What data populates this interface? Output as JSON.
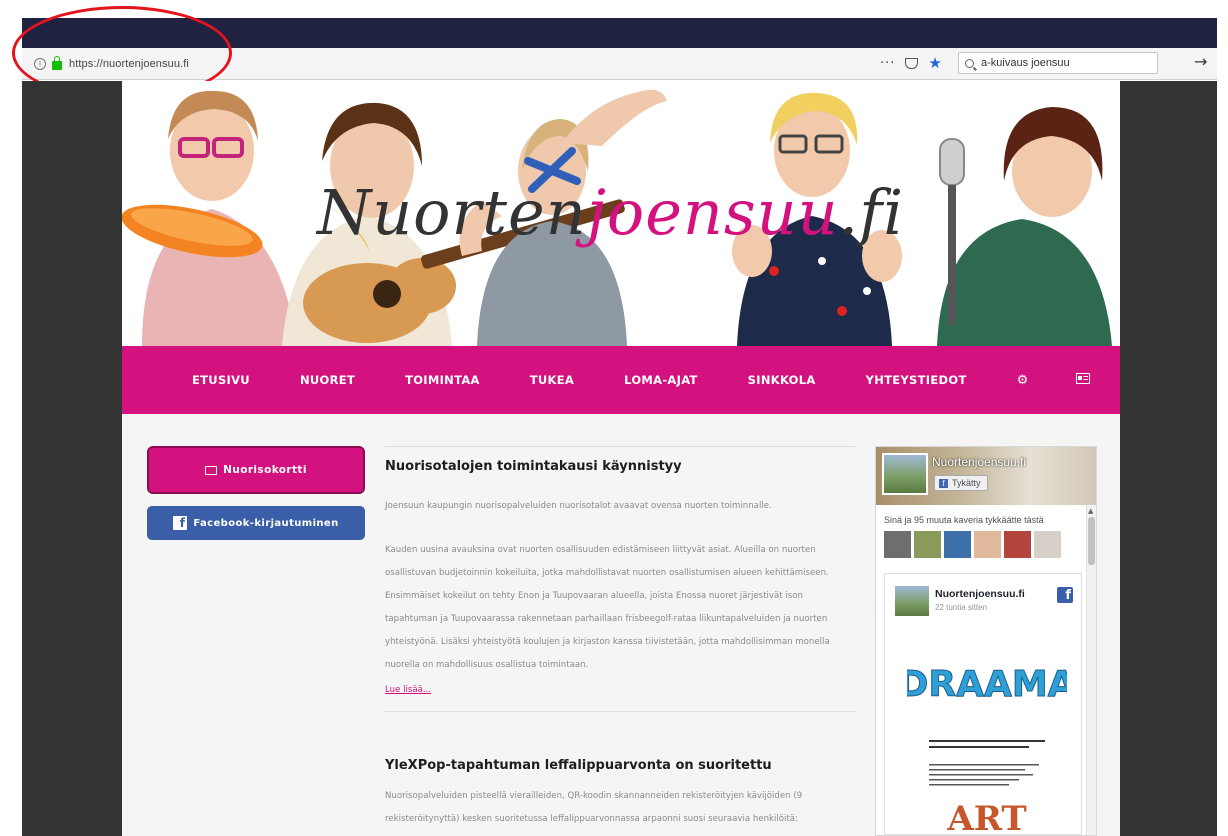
{
  "browser": {
    "url": "https://nuortenjoensuu.fi",
    "page_actions_label": "···",
    "search_value": "a-kuivaus joensuu",
    "colors": {
      "titlebar": "#1f2240",
      "annotation": "#e3141b"
    }
  },
  "site": {
    "logo": {
      "part1": "Nuorten",
      "part2": "joensuu",
      "part3": ".fi"
    },
    "brand_color": "#d4127f",
    "nav": {
      "items": [
        "ETUSIVU",
        "NUORET",
        "TOIMINTAA",
        "TUKEA",
        "LOMA-AJAT",
        "SINKKOLA",
        "YHTEYSTIEDOT"
      ],
      "icons": [
        "gear-icon",
        "id-card-icon"
      ]
    }
  },
  "sidebar": {
    "nuorisokortti_label": "Nuorisokortti",
    "facebook_login_label": "Facebook-kirjautuminen"
  },
  "articles": [
    {
      "title": "Nuorisotalojen toimintakausi käynnistyy",
      "paragraphs": [
        "Joensuun kaupungin nuorisopalveluiden nuorisotalot avaavat ovensa nuorten toiminnalle.",
        "Kauden uusina avauksina ovat nuorten osallisuuden edistämiseen liittyvät asiat. Alueilla on nuorten osallistuvan budjetoinnin kokeiluita, jotka mahdollistavat nuorten osallistumisen alueen kehittämiseen. Ensimmäiset kokeilut on tehty Enon ja Tuupovaaran alueella, joista Enossa nuoret järjestivät ison tapahtuman ja Tuupovaarassa rakennetaan parhaillaan frisbeegolf-rataa liikuntapalveluiden ja nuorten yhteistyönä. Lisäksi yhteistyötä koulujen ja kirjaston kanssa tiivistetään, jotta mahdollisimman monella nuorella on mahdollisuus osallistua toimintaan."
      ],
      "read_more": "Lue lisää..."
    },
    {
      "title": "YleXPop-tapahtuman leffalippuarvonta on suoritettu",
      "paragraphs": [
        "Nuorisopalveluiden pisteellä vierailleiden, QR-koodin skannanneiden rekisteröityjen kävijöiden (9 rekisteröitynyttä) kesken suoritetussa leffalippuarvonnassa arpaonni suosi seuraavia henkilöitä:"
      ]
    }
  ],
  "facebook_widget": {
    "page_name": "Nuortenjoensuu.fi",
    "like_label": "Tykätty",
    "friends_text": "Sinä ja 95 muuta kaveria tykkäätte tästä",
    "post": {
      "author": "Nuortenjoensuu.fi",
      "time": "22 tuntia sitten",
      "poster_title": "DRAAMA",
      "poster_title2": "ART"
    }
  }
}
